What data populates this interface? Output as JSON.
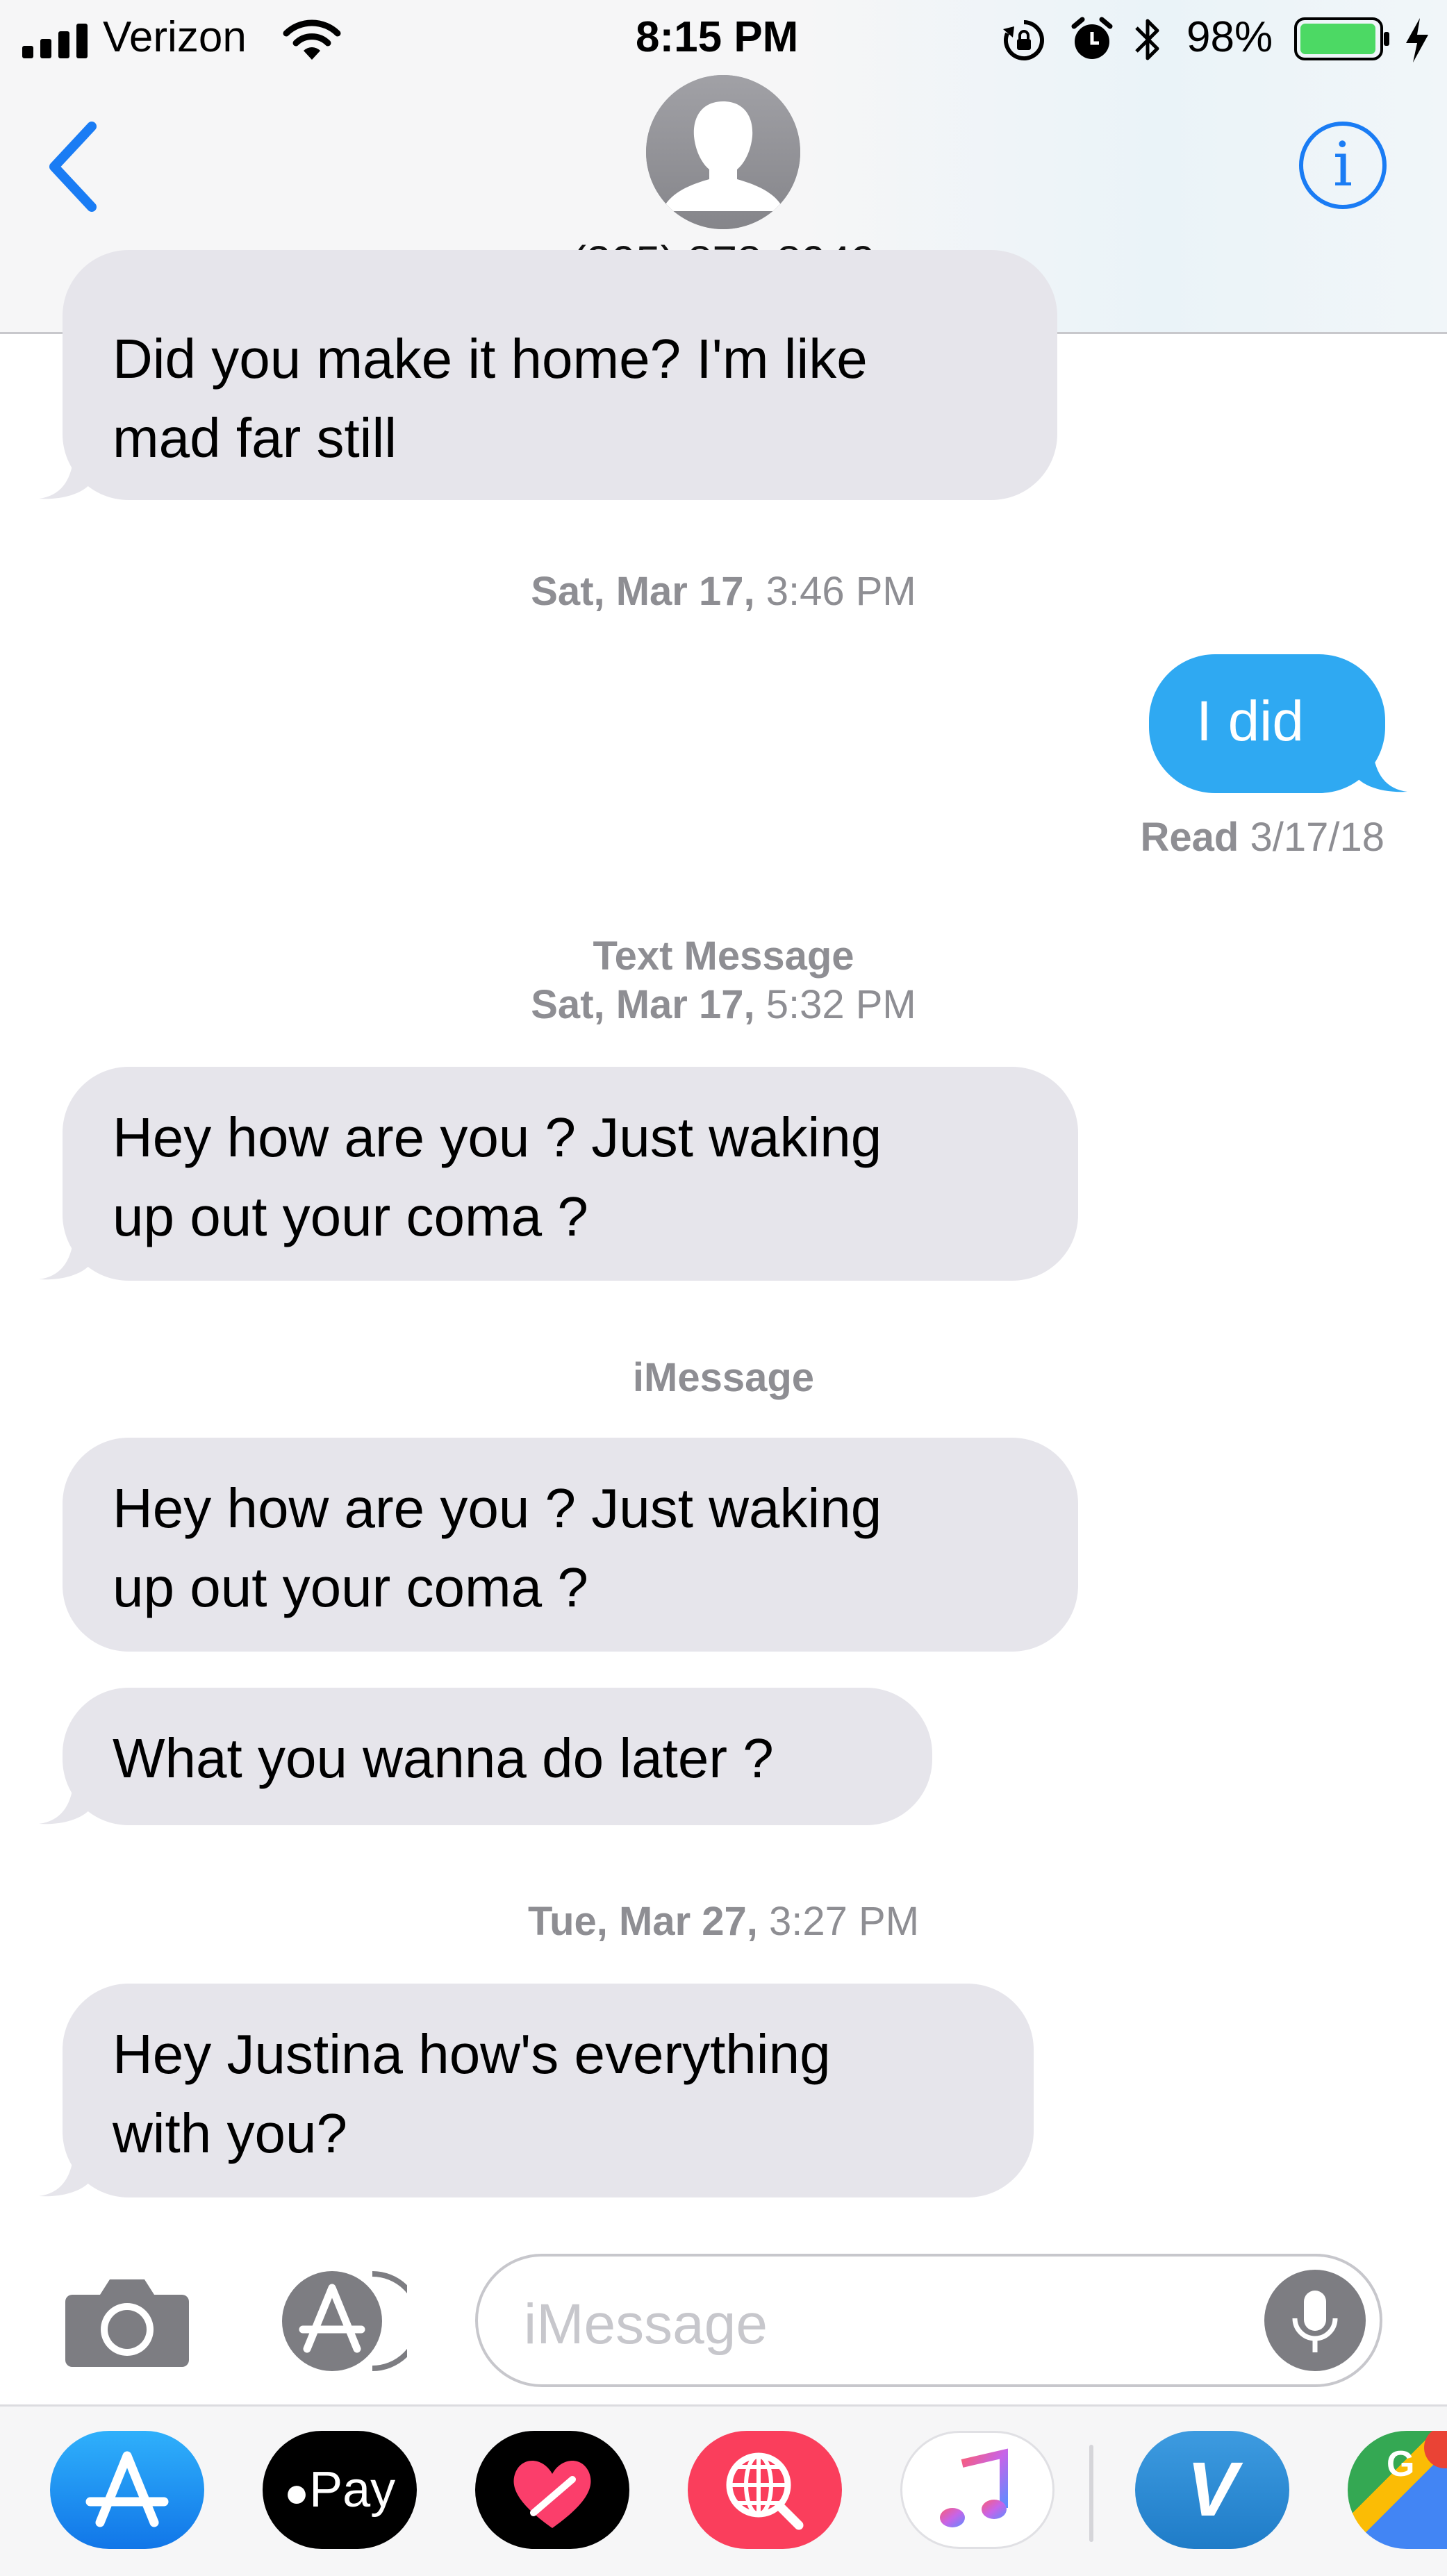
{
  "status_bar": {
    "carrier": "Verizon",
    "time": "8:15 PM",
    "battery_percent": "98%",
    "battery_level": 0.98,
    "icons": [
      "signal-icon",
      "wifi-icon",
      "orientation-lock-icon",
      "alarm-icon",
      "bluetooth-icon",
      "battery-icon",
      "charging-icon"
    ]
  },
  "header": {
    "contact": "(305) 878-8949",
    "back_icon": "chevron-left-icon",
    "info_icon": "info-icon",
    "info_glyph": "i"
  },
  "messages": [
    {
      "type": "received",
      "text": "Did you make it home? I'm like\nmad far still"
    },
    {
      "type": "timestamp",
      "day": "Sat, Mar 17,",
      "time": "3:46 PM"
    },
    {
      "type": "sent",
      "text": "I did"
    },
    {
      "type": "receipt",
      "label": "Read",
      "date": "3/17/18"
    },
    {
      "type": "service",
      "text": "Text Message"
    },
    {
      "type": "timestamp",
      "day": "Sat, Mar 17,",
      "time": "5:32 PM"
    },
    {
      "type": "received",
      "text": "Hey how are you ? Just waking\nup out your coma ?"
    },
    {
      "type": "service",
      "text": "iMessage"
    },
    {
      "type": "received",
      "text": "Hey how are you ? Just waking\nup out your coma ?"
    },
    {
      "type": "received",
      "text": "What you wanna do later ?"
    },
    {
      "type": "timestamp",
      "day": "Tue, Mar 27,",
      "time": "3:27 PM"
    },
    {
      "type": "received",
      "text": "Hey Justina how's everything\nwith you?"
    }
  ],
  "compose": {
    "placeholder": "iMessage",
    "icons": [
      "camera-icon",
      "app-store-icon",
      "microphone-icon"
    ]
  },
  "app_drawer": {
    "apps": [
      "App Store",
      "Apple Pay",
      "Digital Touch",
      "Images Search",
      "Music",
      "Venmo",
      "Google Maps"
    ],
    "apple_pay_label": "Pay",
    "venmo_glyph": "V",
    "maps_glyph": "G"
  },
  "colors": {
    "accent_blue": "#1a7cf4",
    "sent_bubble": "#2fa9f2",
    "received_bubble": "#e6e5eb",
    "meta_gray": "#8e8e93",
    "battery_green": "#4cd964"
  }
}
